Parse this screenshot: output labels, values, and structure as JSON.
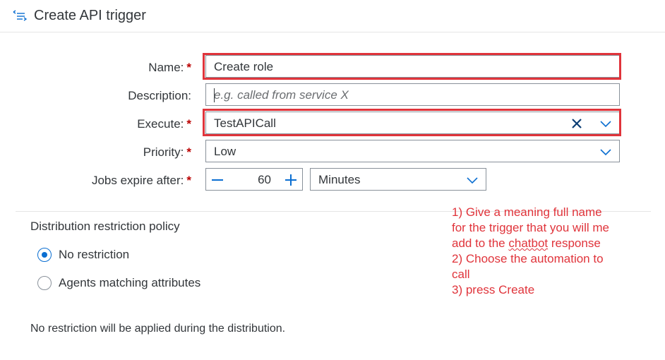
{
  "header": {
    "title": "Create API trigger",
    "icon": "collapse-list-icon"
  },
  "form": {
    "name": {
      "label": "Name:",
      "value": "Create role",
      "required_mark": "*"
    },
    "description": {
      "label": "Description:",
      "placeholder": "e.g. called from service X"
    },
    "execute": {
      "label": "Execute:",
      "value": "TestAPICall",
      "required_mark": "*"
    },
    "priority": {
      "label": "Priority:",
      "value": "Low",
      "required_mark": "*"
    },
    "jobs_expire": {
      "label": "Jobs expire after:",
      "value": "60",
      "unit": "Minutes",
      "required_mark": "*"
    }
  },
  "distribution": {
    "title": "Distribution restriction policy",
    "options": [
      {
        "label": "No restriction",
        "selected": true
      },
      {
        "label": "Agents matching attributes",
        "selected": false
      }
    ],
    "note": "No restriction will be applied during the distribution."
  },
  "annotation": {
    "lines": [
      "1) Give a meaning full name",
      "for the trigger that you will me",
      "add to the",
      "chatbot",
      "response",
      "2) Choose the automation to",
      "call",
      "3) press Create"
    ],
    "color": "#e0343b"
  },
  "colors": {
    "accent": "#0a6ed1",
    "required": "#bb0000",
    "highlight": "#e0343b"
  }
}
